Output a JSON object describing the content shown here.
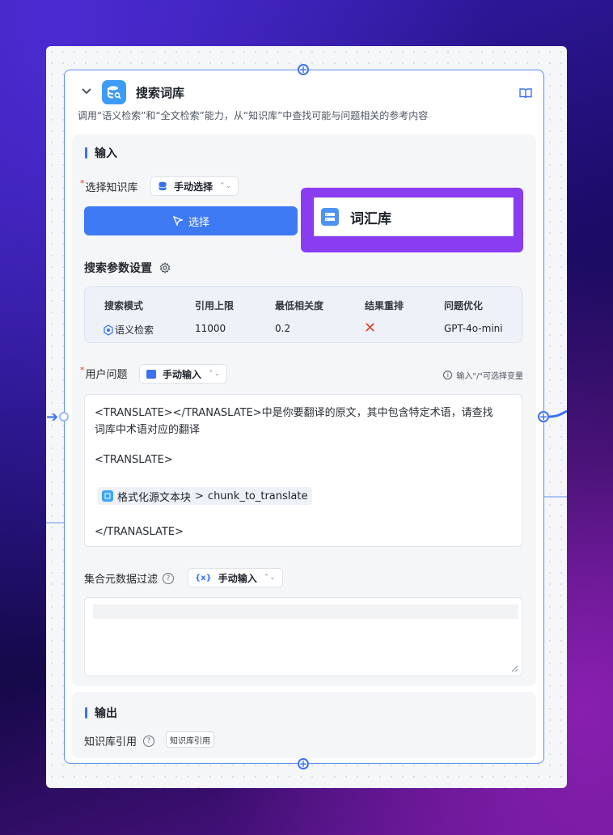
{
  "node": {
    "title": "搜索词库",
    "description": "调用“语义检索”和“全文检索”能力，从“知识库”中查找可能与问题相关的参考内容"
  },
  "input_section": {
    "title": "输入",
    "kb_select": {
      "required_mark": "*",
      "label": "选择知识库",
      "mode": "手动选择",
      "select_button": "选择",
      "selected_kb": "词汇库"
    },
    "search_params": {
      "title": "搜索参数设置",
      "headers": [
        "搜索模式",
        "引用上限",
        "最低相关度",
        "结果重排",
        "问题优化"
      ],
      "values": {
        "mode": "语义检索",
        "limit": "11000",
        "min_similarity": "0.2",
        "rerank": "✕",
        "query_extension": "GPT-4o-mini"
      }
    },
    "user_question": {
      "required_mark": "*",
      "label": "用户问题",
      "mode": "手动输入",
      "hint": "输入\"/\"可选择变量",
      "lines": [
        "<TRANSLATE></TRANASLATE>中是你要翻译的原文，其中包含特定术语，请查找",
        "词库中术语对应的翻译",
        "<TRANSLATE>",
        "</TRANASLATE>"
      ],
      "variable_chip": {
        "name": "格式化源文本块",
        "separator": ">",
        "field": "chunk_to_translate"
      }
    },
    "metadata_filter": {
      "label": "集合元数据过滤",
      "mode": "手动输入"
    }
  },
  "output_section": {
    "title": "输出",
    "kb_ref_label": "知识库引用",
    "kb_ref_tag": "知识库引用"
  },
  "colors": {
    "accent": "#3f7af5",
    "highlight": "#8a3df0",
    "error": "#e2452b"
  }
}
